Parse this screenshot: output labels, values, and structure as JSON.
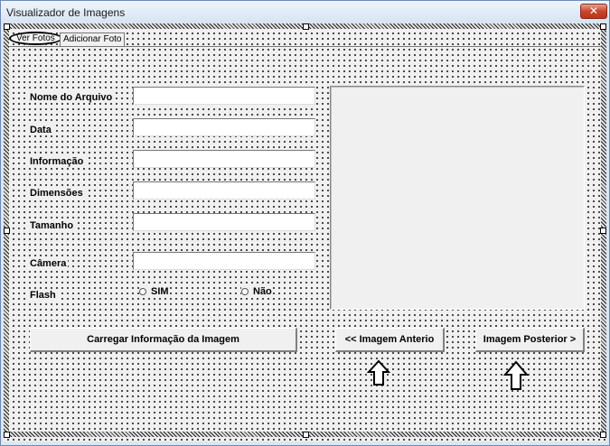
{
  "window": {
    "title": "Visualizador de Imagens",
    "close_glyph": "✕"
  },
  "tabs": [
    {
      "label": "Ver Fotos",
      "active": true
    },
    {
      "label": "Adicionar Foto",
      "active": false
    }
  ],
  "form": {
    "fields": [
      {
        "label": "Nome do Arquivo",
        "value": ""
      },
      {
        "label": "Data",
        "value": ""
      },
      {
        "label": "Informação",
        "value": ""
      },
      {
        "label": "Dimensões",
        "value": ""
      },
      {
        "label": "Tamanho",
        "value": ""
      },
      {
        "label": "Câmera",
        "value": ""
      }
    ],
    "flash_label": "Flash",
    "flash_options": [
      "SIM",
      "Não"
    ]
  },
  "buttons": {
    "load_info": "Carregar Informação da Imagem",
    "previous": "<< Imagem Anterio",
    "next": "Imagem Posterior >"
  },
  "icons": {
    "close": "close-icon",
    "arrow": "up-arrow-icon"
  },
  "colors": {
    "surface": "#f0f0f0",
    "close_button": "#c9452c",
    "title_bar": "#dbe6f3"
  }
}
